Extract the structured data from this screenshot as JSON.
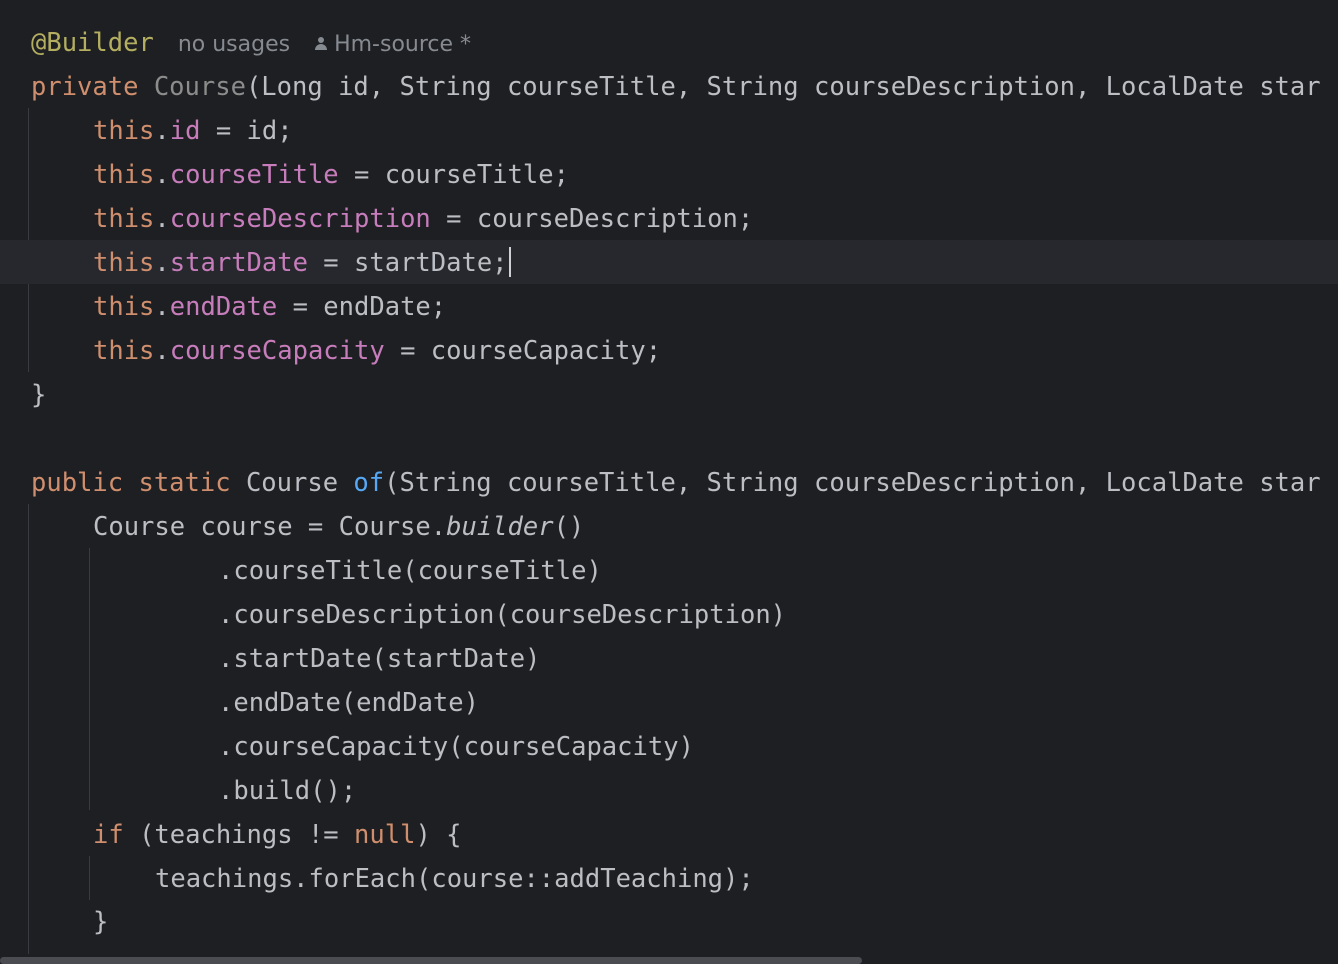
{
  "editor": {
    "inlay": {
      "annotation": "@Builder",
      "usages": "no usages",
      "author": "Hm-source *"
    },
    "lines": {
      "l1": {
        "kw": "private ",
        "ctor": "Course",
        "rest": "(Long id, String courseTitle, String courseDescription, LocalDate star"
      },
      "l2": {
        "this": "this",
        "dot": ".",
        "field": "id",
        "rest": " = id;"
      },
      "l3": {
        "this": "this",
        "dot": ".",
        "field": "courseTitle",
        "rest": " = courseTitle;"
      },
      "l4": {
        "this": "this",
        "dot": ".",
        "field": "courseDescription",
        "rest": " = courseDescription;"
      },
      "l5": {
        "this": "this",
        "dot": ".",
        "field": "startDate",
        "rest": " = startDate;"
      },
      "l6": {
        "this": "this",
        "dot": ".",
        "field": "endDate",
        "rest": " = endDate;"
      },
      "l7": {
        "this": "this",
        "dot": ".",
        "field": "courseCapacity",
        "rest": " = courseCapacity;"
      },
      "l8": {
        "text": "}"
      },
      "l9": {
        "kw1": "public ",
        "kw2": "static ",
        "type": "Course ",
        "fn": "of",
        "rest": "(String courseTitle, String courseDescription, LocalDate star"
      },
      "l10": {
        "pre": "Course course = Course.",
        "method": "builder",
        "post": "()"
      },
      "l11": {
        "text": ".courseTitle(courseTitle)"
      },
      "l12": {
        "text": ".courseDescription(courseDescription)"
      },
      "l13": {
        "text": ".startDate(startDate)"
      },
      "l14": {
        "text": ".endDate(endDate)"
      },
      "l15": {
        "text": ".courseCapacity(courseCapacity)"
      },
      "l16": {
        "text": ".build();"
      },
      "l17": {
        "kw": "if",
        "mid": " (teachings != ",
        "null": "null",
        "post": ") {"
      },
      "l18": {
        "text": "teachings.forEach(course::addTeaching);"
      },
      "l19": {
        "text": "}"
      }
    },
    "colors": {
      "background": "#1e1f22",
      "current_line": "#26282e",
      "keyword": "#cf8e6d",
      "annotation": "#b3ae60",
      "field": "#c77dbb",
      "function": "#56a8f5",
      "text": "#bcbec4",
      "hint": "#868a91"
    }
  }
}
